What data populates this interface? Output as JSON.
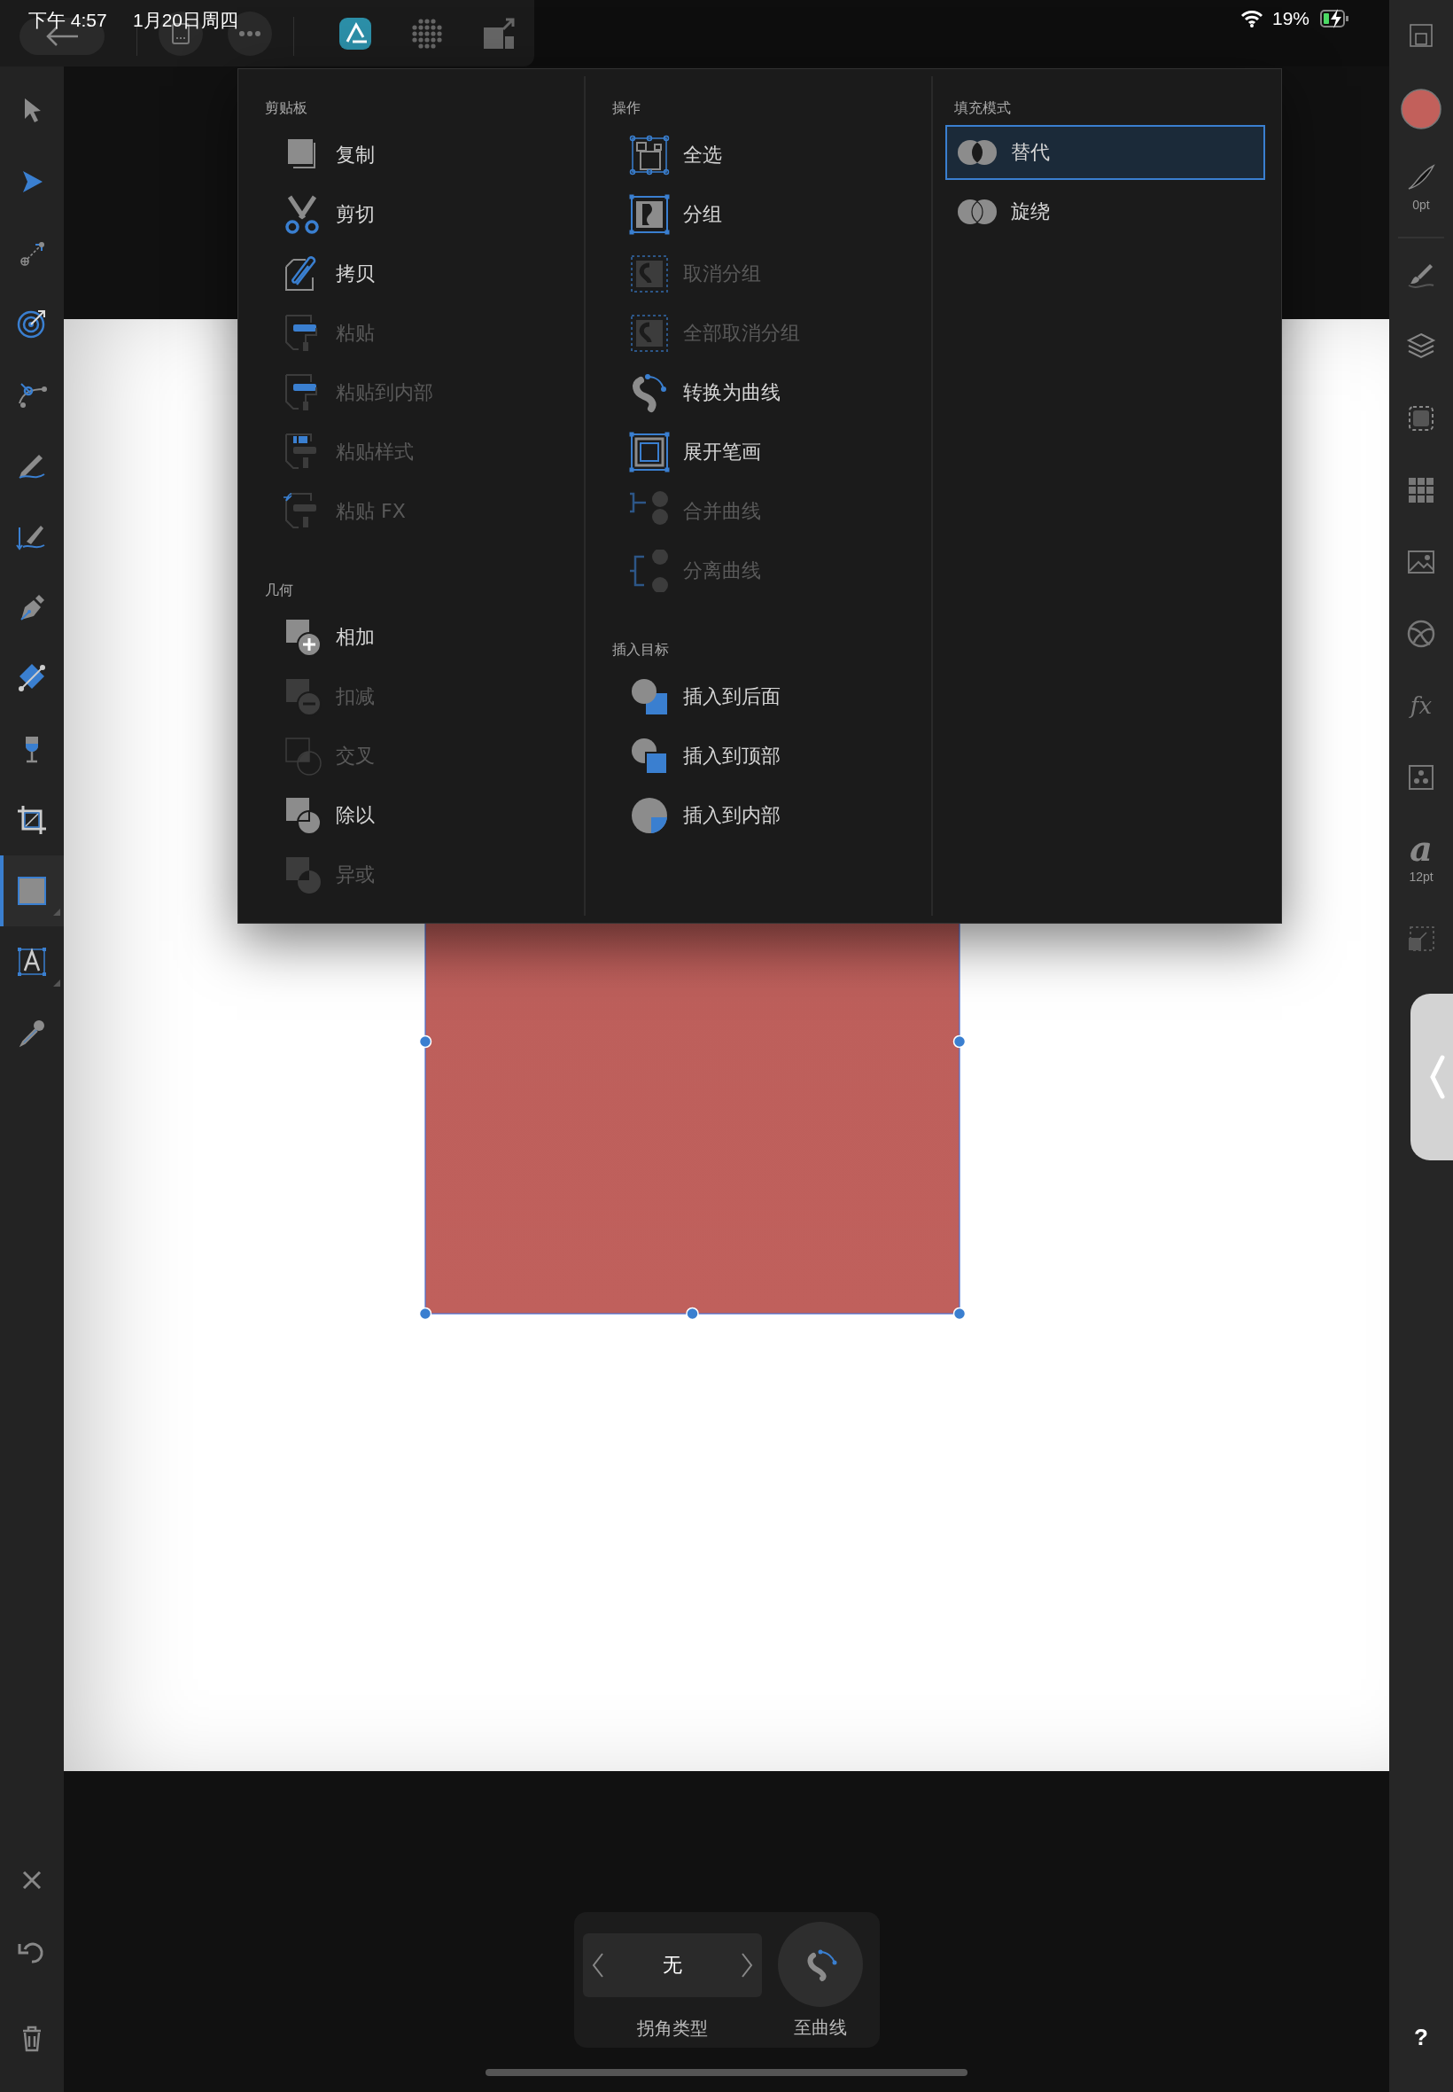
{
  "status_bar": {
    "time": "下午 4:57",
    "date": "1月20日周四",
    "battery": "19%"
  },
  "top_toolbar": {
    "actions": [
      {
        "kind": "back"
      },
      {
        "kind": "document"
      },
      {
        "kind": "more"
      }
    ],
    "personas": [
      {
        "kind": "designer",
        "selected": true
      },
      {
        "kind": "pixel",
        "selected": false
      },
      {
        "kind": "export",
        "selected": false
      }
    ]
  },
  "left_toolbar": {
    "tools": [
      {
        "kind": "move",
        "selected": false
      },
      {
        "kind": "node",
        "selected": false
      },
      {
        "kind": "point-transform",
        "selected": false
      },
      {
        "kind": "target",
        "selected": false
      },
      {
        "kind": "vector-node",
        "selected": false
      },
      {
        "kind": "pencil",
        "selected": false
      },
      {
        "kind": "brush",
        "selected": false
      },
      {
        "kind": "pen",
        "selected": false
      },
      {
        "kind": "gradient",
        "selected": false
      },
      {
        "kind": "transparency",
        "selected": false
      },
      {
        "kind": "crop",
        "selected": false
      },
      {
        "kind": "rectangle",
        "selected": true
      },
      {
        "kind": "text",
        "selected": false
      },
      {
        "kind": "picker",
        "selected": false
      }
    ],
    "actions": [
      {
        "kind": "close"
      },
      {
        "kind": "undo"
      },
      {
        "kind": "delete"
      }
    ]
  },
  "right_toolbar": {
    "items": [
      {
        "kind": "resize"
      },
      {
        "kind": "fill"
      },
      {
        "kind": "stroke",
        "label": "0pt"
      },
      {
        "kind": "brushes"
      },
      {
        "kind": "layers"
      },
      {
        "kind": "appearance"
      },
      {
        "kind": "swatches"
      },
      {
        "kind": "image"
      },
      {
        "kind": "color-wheel"
      },
      {
        "kind": "effects",
        "glyph": "fx"
      },
      {
        "kind": "styles"
      },
      {
        "kind": "text",
        "glyph": "a",
        "label": "12pt"
      },
      {
        "kind": "transform"
      }
    ],
    "help": "?"
  },
  "menu": {
    "columns": [
      {
        "sections": [
          {
            "title": "剪贴板",
            "items": [
              {
                "label": "复制",
                "kind": "copy",
                "disabled": false
              },
              {
                "label": "剪切",
                "kind": "cut",
                "disabled": false
              },
              {
                "label": "拷贝",
                "kind": "clone",
                "disabled": false
              },
              {
                "label": "粘贴",
                "kind": "paste",
                "disabled": true
              },
              {
                "label": "粘贴到内部",
                "kind": "paste",
                "disabled": true
              },
              {
                "label": "粘贴样式",
                "kind": "paste-style",
                "disabled": true
              },
              {
                "label": "粘贴 FX",
                "kind": "paste-fx",
                "disabled": true
              }
            ]
          },
          {
            "title": "几何",
            "items": [
              {
                "label": "相加",
                "kind": "add",
                "disabled": false
              },
              {
                "label": "扣减",
                "kind": "subtract",
                "disabled": true
              },
              {
                "label": "交叉",
                "kind": "intersect",
                "disabled": true
              },
              {
                "label": "除以",
                "kind": "divide",
                "disabled": false
              },
              {
                "label": "异或",
                "kind": "xor",
                "disabled": true
              }
            ]
          }
        ]
      },
      {
        "sections": [
          {
            "title": "操作",
            "items": [
              {
                "label": "全选",
                "kind": "select-all",
                "disabled": false
              },
              {
                "label": "分组",
                "kind": "group",
                "disabled": false
              },
              {
                "label": "取消分组",
                "kind": "ungroup",
                "disabled": true
              },
              {
                "label": "全部取消分组",
                "kind": "ungroup",
                "disabled": true
              },
              {
                "label": "转换为曲线",
                "kind": "curves",
                "disabled": false
              },
              {
                "label": "展开笔画",
                "kind": "expand",
                "disabled": false
              },
              {
                "label": "合并曲线",
                "kind": "join",
                "disabled": true
              },
              {
                "label": "分离曲线",
                "kind": "separate",
                "disabled": true
              }
            ]
          },
          {
            "title": "插入目标",
            "items": [
              {
                "label": "插入到后面",
                "kind": "behind",
                "disabled": false
              },
              {
                "label": "插入到顶部",
                "kind": "top",
                "disabled": false
              },
              {
                "label": "插入到内部",
                "kind": "inside",
                "disabled": false
              }
            ]
          }
        ]
      },
      {
        "sections": [
          {
            "title": "填充模式",
            "items": [
              {
                "label": "替代",
                "kind": "alternate",
                "selected": true
              },
              {
                "label": "旋绕",
                "kind": "winding",
                "selected": false
              }
            ]
          }
        ]
      }
    ]
  },
  "bottom_panel": {
    "corner_type": {
      "value": "无",
      "label": "拐角类型"
    },
    "to_curves": {
      "label": "至曲线"
    }
  }
}
